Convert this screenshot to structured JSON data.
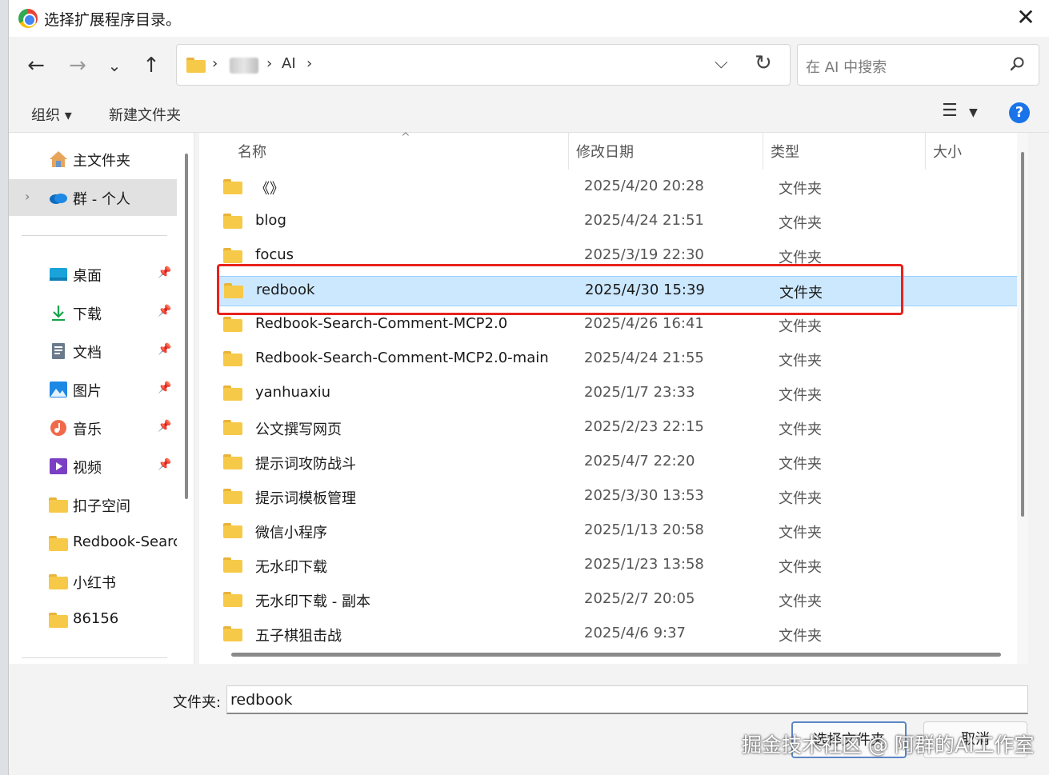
{
  "window": {
    "title": "选择扩展程序目录。"
  },
  "address": {
    "crumbs": [
      "AI"
    ]
  },
  "search": {
    "placeholder": "在 AI 中搜索"
  },
  "commands": {
    "organize": "组织 ▾",
    "new_folder": "新建文件夹"
  },
  "sidebar": {
    "items": [
      {
        "label": "主文件夹",
        "icon": "home-icon"
      },
      {
        "label": "群 - 个人",
        "icon": "onedrive-icon"
      },
      {
        "label": "桌面",
        "icon": "desktop-icon"
      },
      {
        "label": "下载",
        "icon": "download-icon"
      },
      {
        "label": "文档",
        "icon": "document-icon"
      },
      {
        "label": "图片",
        "icon": "picture-icon"
      },
      {
        "label": "音乐",
        "icon": "music-icon"
      },
      {
        "label": "视频",
        "icon": "video-icon"
      },
      {
        "label": "扣子空间",
        "icon": "folder-icon"
      },
      {
        "label": "Redbook-Search",
        "icon": "folder-icon"
      },
      {
        "label": "小红书",
        "icon": "folder-icon"
      },
      {
        "label": "86156",
        "icon": "folder-icon"
      }
    ]
  },
  "columns": {
    "name": "名称",
    "modified": "修改日期",
    "type": "类型",
    "size": "大小"
  },
  "files": [
    {
      "name": "《》",
      "modified": "2025/4/20 20:28",
      "type": "文件夹"
    },
    {
      "name": "blog",
      "modified": "2025/4/24 21:51",
      "type": "文件夹"
    },
    {
      "name": "focus",
      "modified": "2025/3/19 22:30",
      "type": "文件夹"
    },
    {
      "name": "redbook",
      "modified": "2025/4/30 15:39",
      "type": "文件夹",
      "selected": true
    },
    {
      "name": "Redbook-Search-Comment-MCP2.0",
      "modified": "2025/4/26 16:41",
      "type": "文件夹"
    },
    {
      "name": "Redbook-Search-Comment-MCP2.0-main",
      "modified": "2025/4/24 21:55",
      "type": "文件夹"
    },
    {
      "name": "yanhuaxiu",
      "modified": "2025/1/7 23:33",
      "type": "文件夹"
    },
    {
      "name": "公文撰写网页",
      "modified": "2025/2/23 22:15",
      "type": "文件夹"
    },
    {
      "name": "提示词攻防战斗",
      "modified": "2025/4/7 22:20",
      "type": "文件夹"
    },
    {
      "name": "提示词模板管理",
      "modified": "2025/3/30 13:53",
      "type": "文件夹"
    },
    {
      "name": "微信小程序",
      "modified": "2025/1/13 20:58",
      "type": "文件夹"
    },
    {
      "name": "无水印下载",
      "modified": "2025/1/23 13:58",
      "type": "文件夹"
    },
    {
      "name": "无水印下载 - 副本",
      "modified": "2025/2/7 20:05",
      "type": "文件夹"
    },
    {
      "name": "五子棋狙击战",
      "modified": "2025/4/6 9:37",
      "type": "文件夹"
    }
  ],
  "footer": {
    "folder_label": "文件夹:",
    "folder_value": "redbook",
    "select_button": "选择文件夹",
    "cancel_button": "取消",
    "watermark": "掘金技术社区 @ 阿群的AI工作室"
  },
  "colors": {
    "selection": "#cce8ff",
    "highlight_box": "#e8221c",
    "accent": "#1a73e8"
  }
}
